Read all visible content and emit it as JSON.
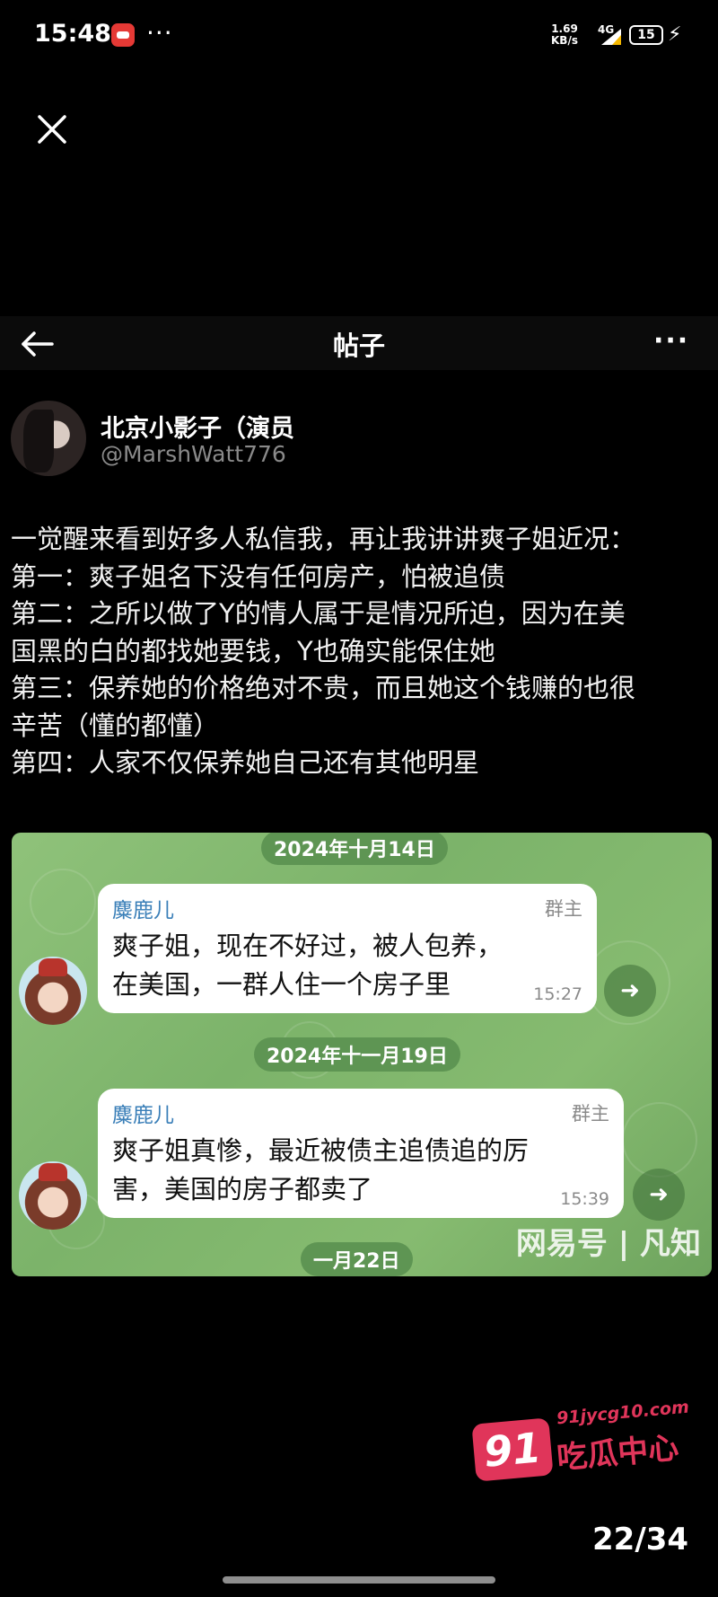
{
  "status_bar": {
    "time": "15:48",
    "more": "···",
    "net_speed_value": "1.69",
    "net_speed_unit": "KB/s",
    "signal_label": "4G",
    "battery": "15",
    "notification_icon": "app-notification-icon"
  },
  "header": {
    "title": "帖子",
    "more": "···"
  },
  "post": {
    "author_name": "北京小影子（演员",
    "author_handle": "@MarshWatt776",
    "lines": [
      "一觉醒来看到好多人私信我，再让我讲讲爽子姐近况：",
      "第一：爽子姐名下没有任何房产，怕被追债",
      "第二：之所以做了Y的情人属于是情况所迫，因为在美",
      "国黑的白的都找她要钱，Y也确实能保住她",
      "第三：保养她的价格绝对不贵，而且她这个钱赚的也很",
      "辛苦（懂的都懂）",
      "第四：人家不仅保养她自己还有其他明星"
    ]
  },
  "chat_image": {
    "dates": [
      "2024年十月14日",
      "2024年十一月19日",
      "一月22日"
    ],
    "messages": [
      {
        "sender": "麋鹿儿",
        "role": "群主",
        "text_line1": "爽子姐，现在不好过，被人包养，",
        "text_line2": "在美国，一群人住一个房子里",
        "time": "15:27"
      },
      {
        "sender": "麋鹿儿",
        "role": "群主",
        "text_line1": "爽子姐真惨，最近被债主追债追的厉",
        "text_line2": "害，美国的房子都卖了",
        "time": "15:39"
      }
    ],
    "watermark": "网易号 | 凡知"
  },
  "site_watermark": {
    "badge": "91",
    "url": "91jycg10.com",
    "text": "吃瓜中心"
  },
  "pager": {
    "counter": "22/34"
  }
}
